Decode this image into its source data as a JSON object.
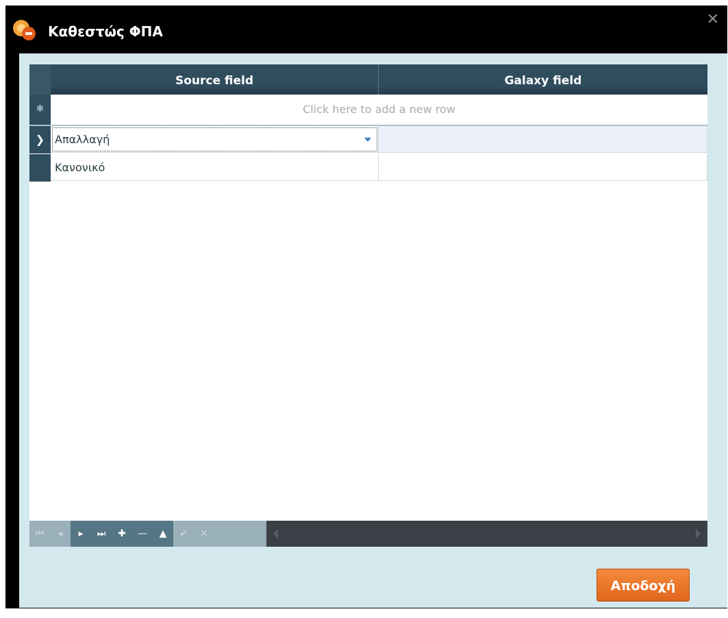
{
  "window": {
    "title": "Καθεστώς ΦΠΑ",
    "close_symbol": "✕"
  },
  "grid": {
    "columns": [
      "Source field",
      "Galaxy field"
    ],
    "new_row_text": "Click here to add a new row",
    "new_row_icon": "✱",
    "row_indicator": "❯",
    "rows": [
      {
        "source": "Απαλλαγή",
        "galaxy": "",
        "selected": true
      },
      {
        "source": "Κανονικό",
        "galaxy": "",
        "selected": false
      }
    ]
  },
  "navigator": {
    "buttons": [
      {
        "name": "first-record-icon",
        "glyph": "⏮"
      },
      {
        "name": "prev-record-icon",
        "glyph": "◂"
      },
      {
        "name": "next-record-icon",
        "glyph": "▸"
      },
      {
        "name": "last-record-icon",
        "glyph": "⏭"
      },
      {
        "name": "add-record-icon",
        "glyph": "✚"
      },
      {
        "name": "delete-record-icon",
        "glyph": "—"
      },
      {
        "name": "edit-record-icon",
        "glyph": "▲"
      },
      {
        "name": "post-edit-icon",
        "glyph": "✔"
      },
      {
        "name": "cancel-edit-icon",
        "glyph": "✕"
      }
    ]
  },
  "footer": {
    "accept_label": "Αποδοχή"
  },
  "colors": {
    "accent": "#e9742b",
    "header": "#304d5e",
    "dialog_bg": "#d4e9ee"
  }
}
